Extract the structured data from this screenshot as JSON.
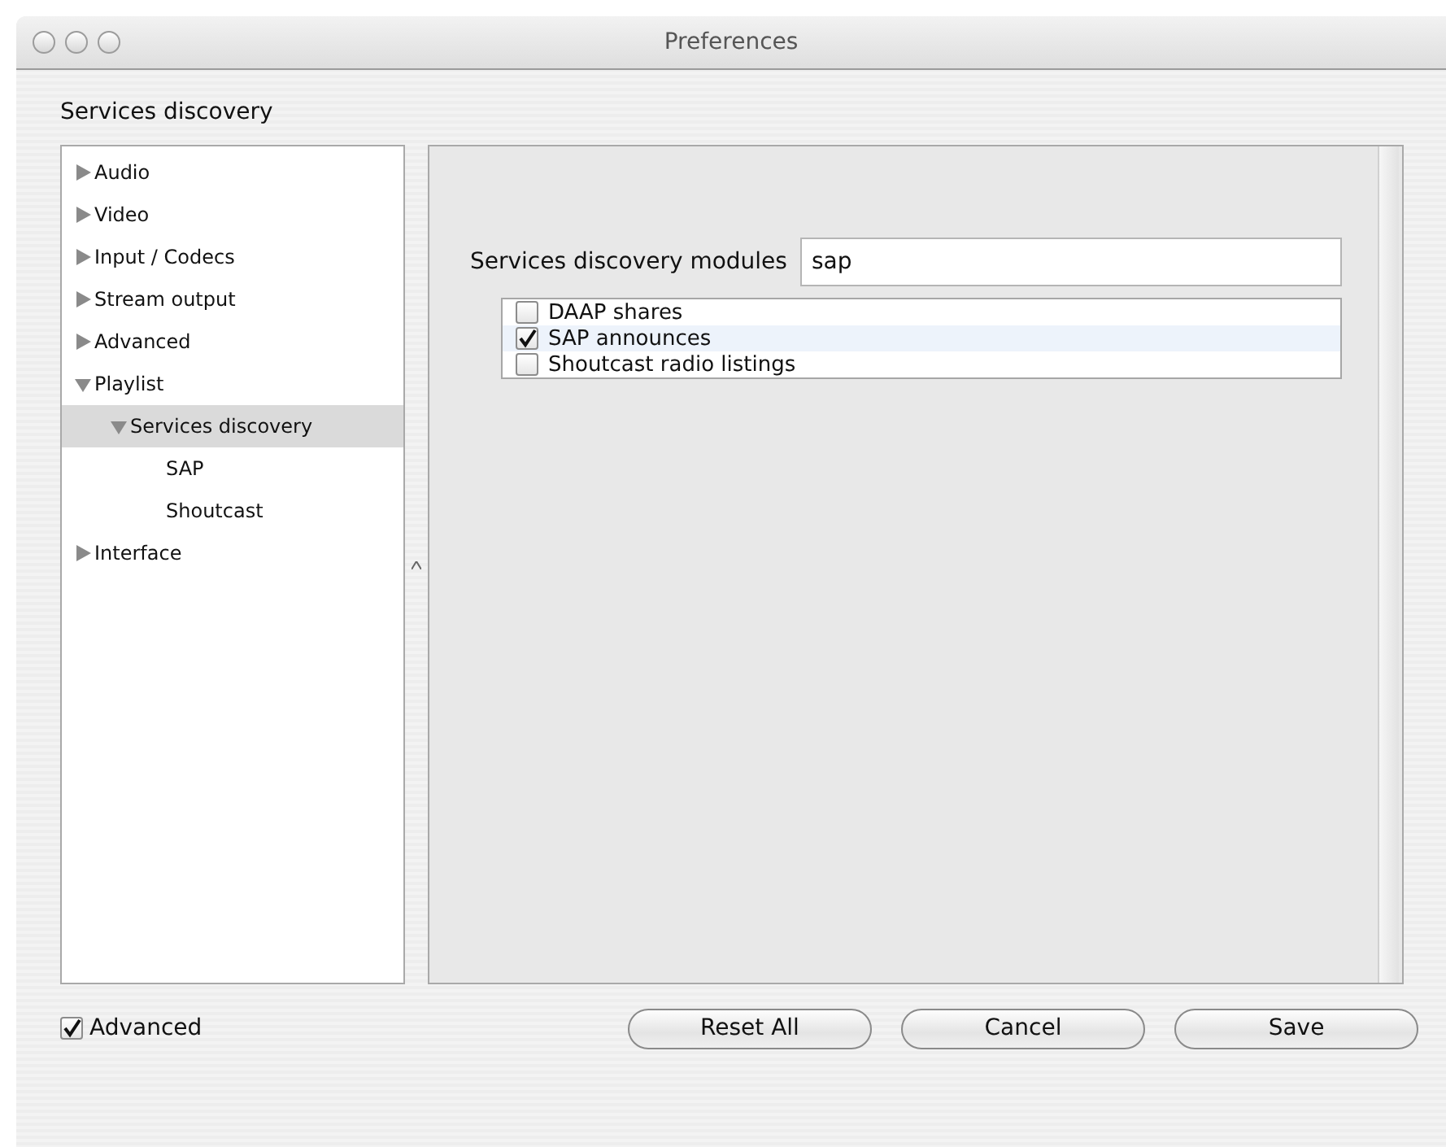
{
  "window": {
    "title": "Preferences"
  },
  "section_title": "Services discovery",
  "tree": [
    {
      "label": "Audio",
      "expanded": false,
      "selected": false
    },
    {
      "label": "Video",
      "expanded": false,
      "selected": false
    },
    {
      "label": "Input / Codecs",
      "expanded": false,
      "selected": false
    },
    {
      "label": "Stream output",
      "expanded": false,
      "selected": false
    },
    {
      "label": "Advanced",
      "expanded": false,
      "selected": false
    },
    {
      "label": "Playlist",
      "expanded": true,
      "selected": false,
      "children": [
        {
          "label": "Services discovery",
          "expanded": true,
          "selected": true,
          "children": [
            {
              "label": "SAP",
              "selected": false
            },
            {
              "label": "Shoutcast",
              "selected": false
            }
          ]
        }
      ]
    },
    {
      "label": "Interface",
      "expanded": false,
      "selected": false
    }
  ],
  "modules_field": {
    "label": "Services discovery modules",
    "value": "sap"
  },
  "modules": [
    {
      "label": "DAAP shares",
      "checked": false,
      "selected": false
    },
    {
      "label": "SAP announces",
      "checked": true,
      "selected": true
    },
    {
      "label": "Shoutcast radio listings",
      "checked": false,
      "selected": false
    }
  ],
  "advanced_checkbox": {
    "label": "Advanced",
    "checked": true
  },
  "buttons": [
    "Reset All",
    "Cancel",
    "Save"
  ]
}
